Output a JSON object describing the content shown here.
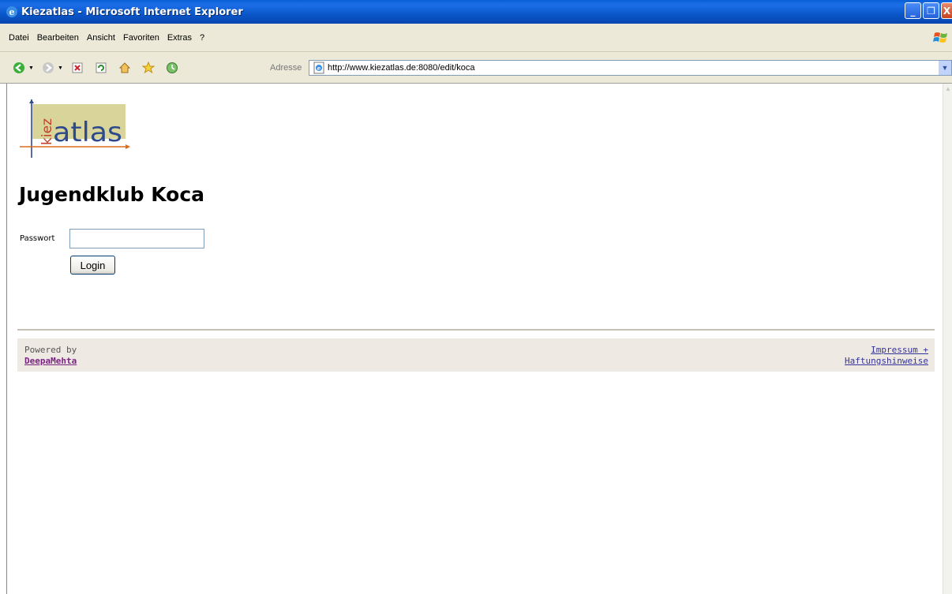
{
  "window": {
    "title": "Kiezatlas - Microsoft Internet Explorer",
    "minimize_glyph": "_",
    "maximize_glyph": "❐",
    "close_glyph": "X"
  },
  "menubar": {
    "items": [
      "Datei",
      "Bearbeiten",
      "Ansicht",
      "Favoriten",
      "Extras",
      "?"
    ]
  },
  "toolbar": {
    "icons": [
      "back-icon",
      "forward-icon",
      "stop-icon",
      "refresh-icon",
      "home-icon",
      "favorites-icon",
      "history-icon"
    ],
    "address_label": "Adresse",
    "address_url": "http://www.kiezatlas.de:8080/edit/koca"
  },
  "page": {
    "logo": {
      "word_vertical": "kiez",
      "word_main": "atlas"
    },
    "title": "Jugendklub Koca",
    "password_label": "Passwort",
    "password_value": "",
    "login_label": "Login",
    "footer": {
      "powered_by": "Powered by",
      "powered_link": "DeepaMehta",
      "impressum_line1": "Impressum +",
      "impressum_line2": "Haftungshinweise"
    }
  },
  "colors": {
    "titlebar": "#0a57c9",
    "chrome": "#ece9d8",
    "footer_bg": "#efe9e4",
    "visited_link": "#7a2282",
    "link": "#333399",
    "logo_bg": "#d8d49a",
    "logo_text": "#2c4a8c",
    "logo_axis": "#e06a1a"
  }
}
